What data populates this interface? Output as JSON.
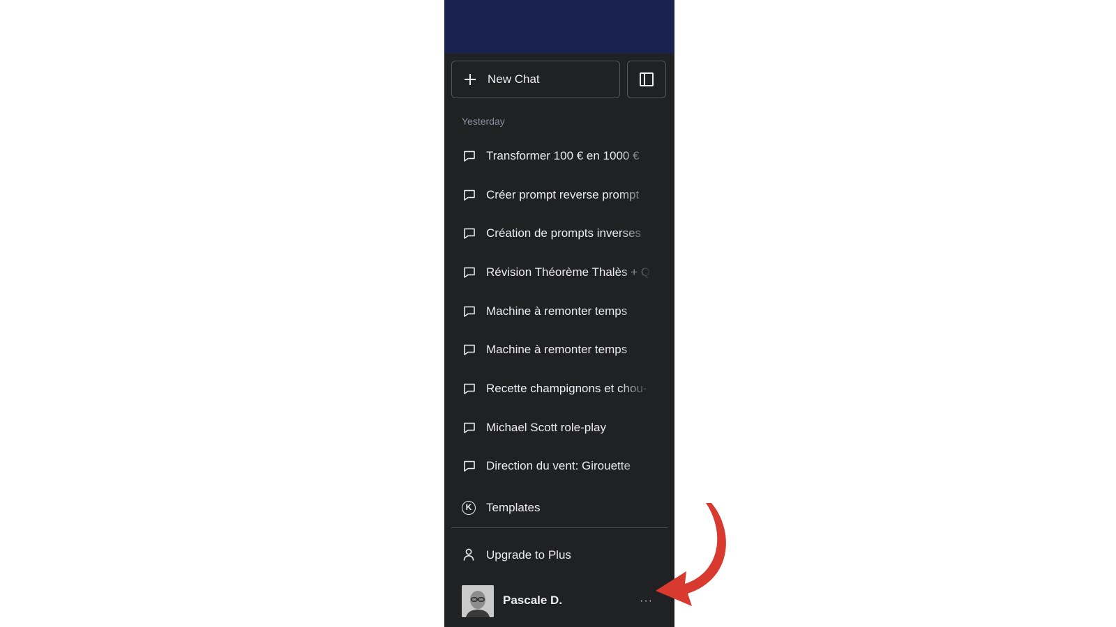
{
  "sidebar": {
    "new_chat_label": "New Chat",
    "section_label": "Yesterday",
    "history": [
      {
        "title": "Transformer 100 € en 1000 €"
      },
      {
        "title": "Créer prompt reverse prompt"
      },
      {
        "title": "Création de prompts inverses"
      },
      {
        "title": "Révision Théorème Thalès + Q"
      },
      {
        "title": "Machine à remonter temps"
      },
      {
        "title": "Machine à remonter temps"
      },
      {
        "title": "Recette champignons et chou-"
      },
      {
        "title": "Michael Scott role-play"
      },
      {
        "title": "Direction du vent: Girouette"
      }
    ],
    "templates_label": "Templates",
    "templates_icon_letter": "K",
    "upgrade_label": "Upgrade to Plus",
    "account": {
      "name": "Pascale D.",
      "more_label": "···"
    }
  },
  "icons": {
    "new_chat": "plus-icon",
    "toggle": "sidebar-toggle-icon",
    "history_item": "chat-bubble-icon",
    "templates": "k-circle-icon",
    "upgrade": "user-icon",
    "more": "ellipsis-icon",
    "annotation": "red-arrow"
  },
  "colors": {
    "sidebar_bg": "#202123",
    "top_bar": "#1a2350",
    "text": "#ececf1",
    "muted": "#8e8ea0",
    "arrow": "#d93a2f"
  }
}
